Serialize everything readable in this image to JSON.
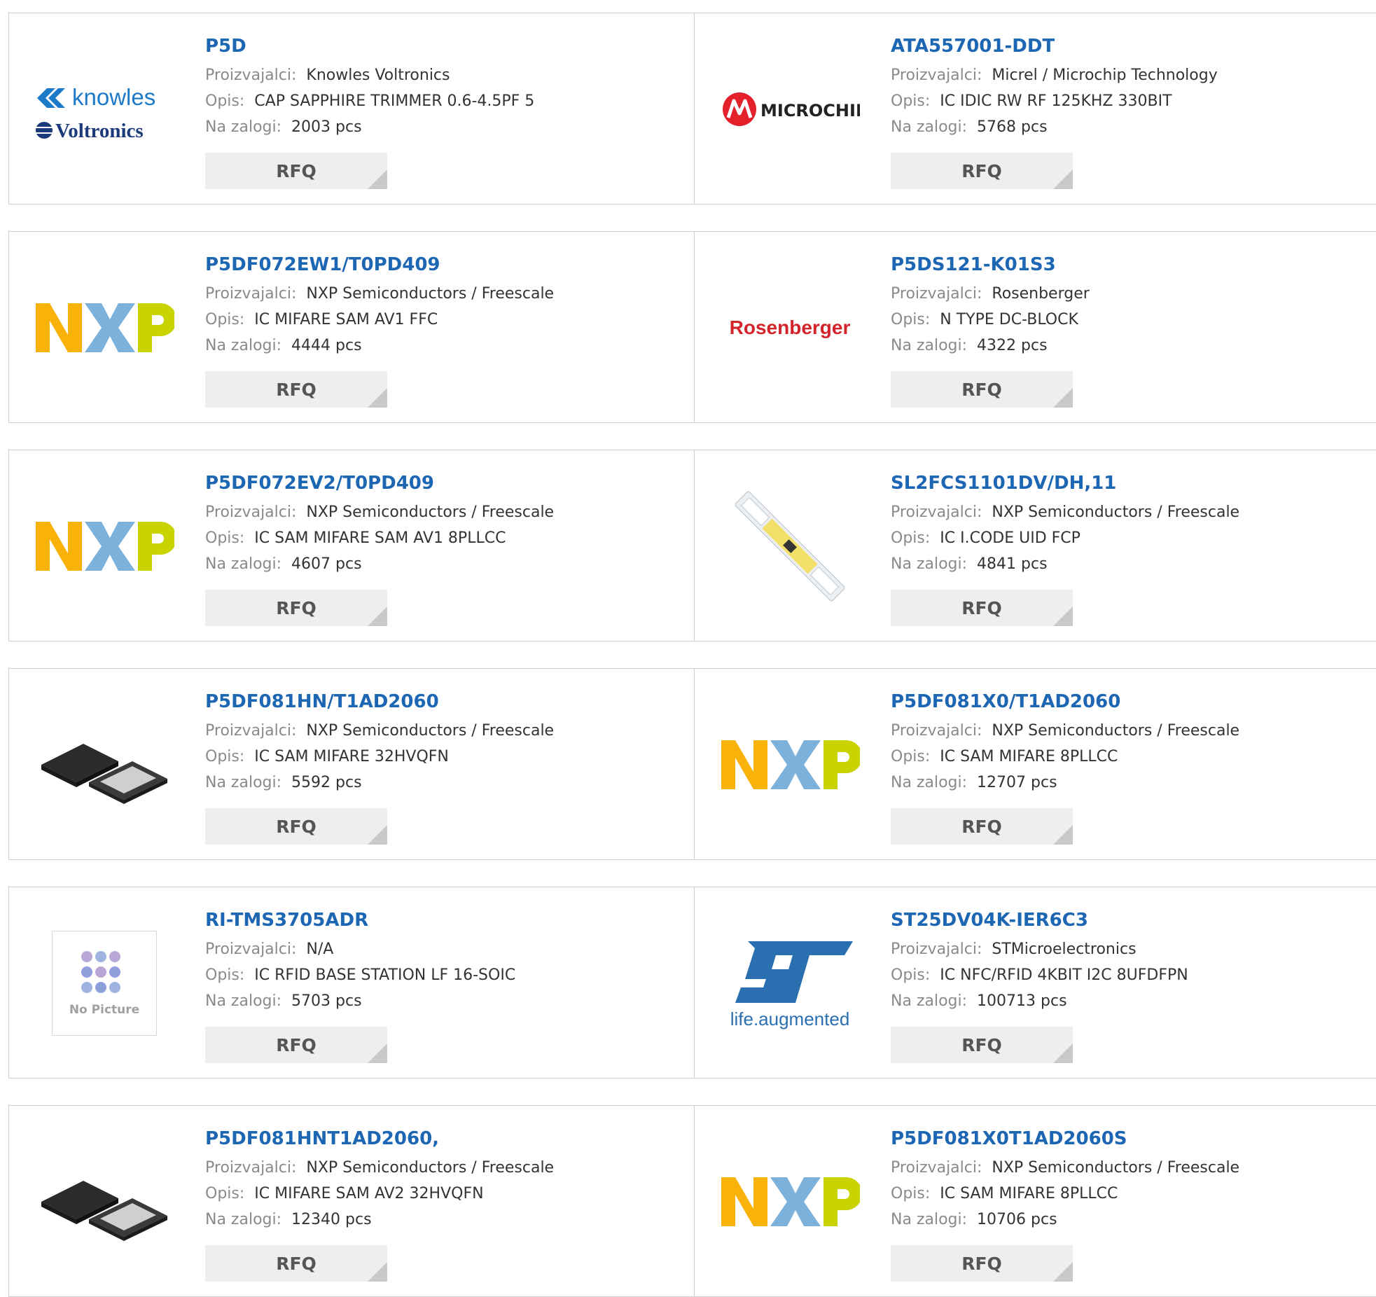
{
  "labels": {
    "manufacturer": "Proizvajalci:",
    "description": "Opis:",
    "stock": "Na zalogi:",
    "rfq": "RFQ"
  },
  "logo_text": {
    "knowles": "knowles",
    "voltronics": "Voltronics",
    "microchip": "MICROCHIP",
    "rosenberger": "Rosenberger",
    "st_tagline": "life.augmented",
    "no_picture": "No Picture"
  },
  "products": [
    {
      "part": "P5D",
      "manufacturer": "Knowles Voltronics",
      "description": "CAP SAPPHIRE TRIMMER 0.6-4.5PF 5",
      "stock": "2003 pcs",
      "logo": "knowles-voltronics-logo"
    },
    {
      "part": "ATA557001-DDT",
      "manufacturer": "Micrel / Microchip Technology",
      "description": "IC IDIC RW RF 125KHZ 330BIT",
      "stock": "5768 pcs",
      "logo": "microchip-logo"
    },
    {
      "part": "P5DF072EW1/T0PD409",
      "manufacturer": "NXP Semiconductors / Freescale",
      "description": "IC MIFARE SAM AV1 FFC",
      "stock": "4444 pcs",
      "logo": "nxp-logo"
    },
    {
      "part": "P5DS121-K01S3",
      "manufacturer": "Rosenberger",
      "description": "N TYPE DC-BLOCK",
      "stock": "4322 pcs",
      "logo": "rosenberger-logo"
    },
    {
      "part": "P5DF072EV2/T0PD409",
      "manufacturer": "NXP Semiconductors / Freescale",
      "description": "IC SAM MIFARE SAM AV1 8PLLCC",
      "stock": "4607 pcs",
      "logo": "nxp-logo"
    },
    {
      "part": "SL2FCS1101DV/DH,11",
      "manufacturer": "NXP Semiconductors / Freescale",
      "description": "IC I.CODE UID FCP",
      "stock": "4841 pcs",
      "logo": "rfid-strip-photo"
    },
    {
      "part": "P5DF081HN/T1AD2060",
      "manufacturer": "NXP Semiconductors / Freescale",
      "description": "IC SAM MIFARE 32HVQFN",
      "stock": "5592 pcs",
      "logo": "qfn-chip-photo"
    },
    {
      "part": "P5DF081X0/T1AD2060",
      "manufacturer": "NXP Semiconductors / Freescale",
      "description": "IC SAM MIFARE 8PLLCC",
      "stock": "12707 pcs",
      "logo": "nxp-logo"
    },
    {
      "part": "RI-TMS3705ADR",
      "manufacturer": "N/A",
      "description": "IC RFID BASE STATION LF 16-SOIC",
      "stock": "5703 pcs",
      "logo": "no-picture-placeholder"
    },
    {
      "part": "ST25DV04K-IER6C3",
      "manufacturer": "STMicroelectronics",
      "description": "IC NFC/RFID 4KBIT I2C 8UFDFPN",
      "stock": "100713 pcs",
      "logo": "st-logo"
    },
    {
      "part": "P5DF081HNT1AD2060,",
      "manufacturer": "NXP Semiconductors / Freescale",
      "description": "IC MIFARE SAM AV2 32HVQFN",
      "stock": "12340 pcs",
      "logo": "qfn-chip-photo"
    },
    {
      "part": "P5DF081X0T1AD2060S",
      "manufacturer": "NXP Semiconductors / Freescale",
      "description": "IC SAM MIFARE 8PLLCC",
      "stock": "10706 pcs",
      "logo": "nxp-logo"
    }
  ],
  "colors": {
    "part_link": "#1d66b3",
    "label": "#8a8a8a",
    "value": "#333333",
    "rfq_bg": "#eeeeee",
    "border": "#d0d0d0",
    "nxp_orange": "#f9b20a",
    "nxp_blue": "#7bb1db",
    "nxp_green": "#c9d300",
    "knowles_blue": "#1d7ac8",
    "voltronics_navy": "#1a3a7a",
    "microchip_red": "#e4202b",
    "rosenberger_red": "#d3242c",
    "st_blue": "#2a6fb0"
  }
}
